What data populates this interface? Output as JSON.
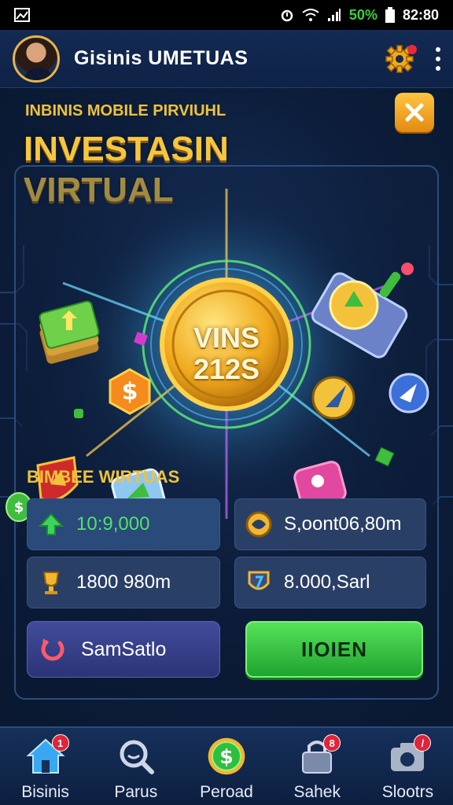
{
  "status_bar": {
    "battery_percent": "50%",
    "time": "82:80"
  },
  "header": {
    "title": "Gisinis UMETUAS"
  },
  "promo": {
    "eyebrow": "INBINIS MOBILE PIRVIUHL",
    "title": "INVESTASIN VIRTUAL",
    "coin_text": "VINS 212S"
  },
  "section_title": "BIMBEE WIRTUAS",
  "stats": [
    {
      "value": "10:9,000",
      "icon": "up-arrow-icon"
    },
    {
      "value": "S,oont06,80m",
      "icon": "globe-coin-icon"
    },
    {
      "value": "1800 980m",
      "icon": "trophy-icon"
    },
    {
      "value": "8.000,Sarl",
      "icon": "shield-icon"
    }
  ],
  "actions": {
    "secondary_label": "SamSatlo",
    "primary_label": "IIOIEN"
  },
  "nav": [
    {
      "label": "Bisinis",
      "icon": "home-icon",
      "badge": "1"
    },
    {
      "label": "Parus",
      "icon": "search-icon",
      "badge": ""
    },
    {
      "label": "Peroad",
      "icon": "dollar-icon",
      "badge": ""
    },
    {
      "label": "Sahek",
      "icon": "lock-icon",
      "badge": "8"
    },
    {
      "label": "Slootrs",
      "icon": "camera-icon",
      "badge": "/"
    }
  ],
  "colors": {
    "accent_gold": "#f0c23a",
    "primary_green": "#2fbf3f",
    "badge_red": "#e0243a",
    "background": "#0b1a33"
  }
}
